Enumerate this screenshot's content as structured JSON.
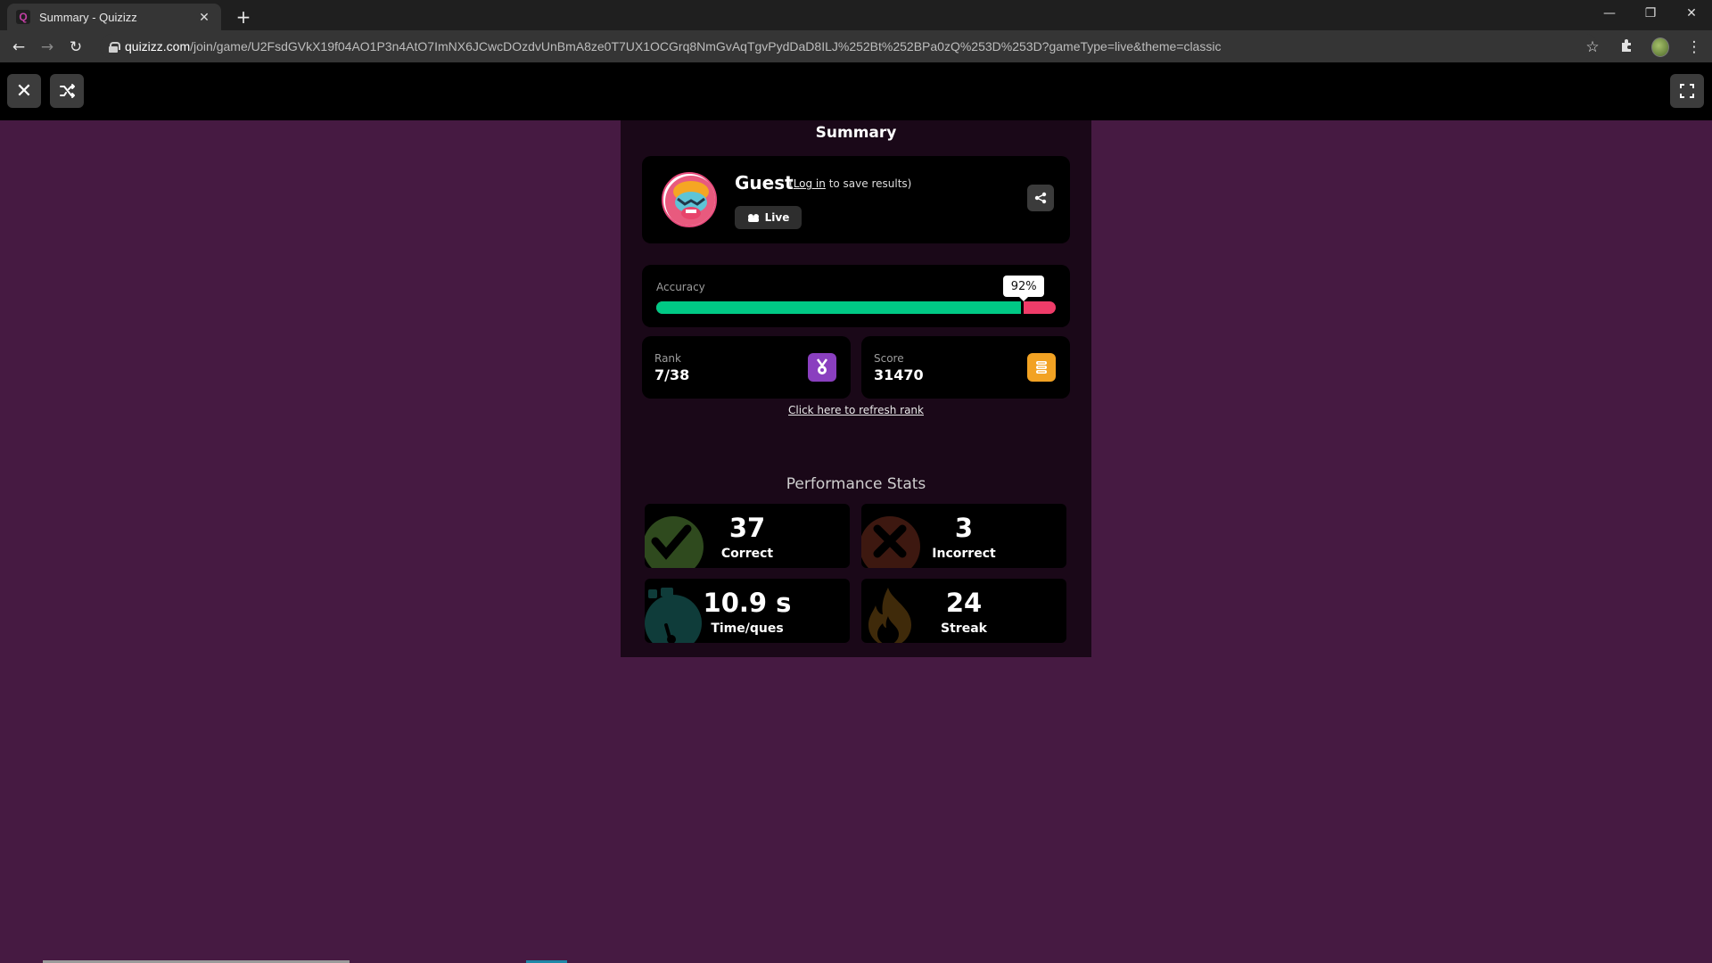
{
  "browser": {
    "tab_title": "Summary - Quizizz",
    "favicon": "Q",
    "url_host": "quizizz.com",
    "url_path": "/join/game/U2FsdGVkX19f04AO1P3n4AtO7ImNX6JCwcDOzdvUnBmA8ze0T7UX1OCGrq8NmGvAqTgvPydDaD8ILJ%252Bt%252BPa0zQ%253D%253D?gameType=live&theme=classic"
  },
  "summary": {
    "title": "Summary",
    "player_name": "Guest",
    "login_prefix": "(",
    "login_link": "Log in",
    "login_suffix": " to save results)",
    "mode": "Live"
  },
  "accuracy": {
    "label": "Accuracy",
    "percent_text": "92%",
    "value": 92,
    "correct_color": "#00c985",
    "incorrect_color": "#ef3c69"
  },
  "rank": {
    "label": "Rank",
    "value": "7/38",
    "icon": "medal-icon",
    "color": "#8a3fbf"
  },
  "score": {
    "label": "Score",
    "value": "31470",
    "icon": "coins-icon",
    "color": "#f2a223"
  },
  "refresh_link": "Click here to refresh rank",
  "performance": {
    "title": "Performance Stats",
    "correct": {
      "value": "37",
      "label": "Correct"
    },
    "incorrect": {
      "value": "3",
      "label": "Incorrect"
    },
    "time": {
      "value": "10.9 s",
      "label": "Time/ques"
    },
    "streak": {
      "value": "24",
      "label": "Streak"
    }
  }
}
